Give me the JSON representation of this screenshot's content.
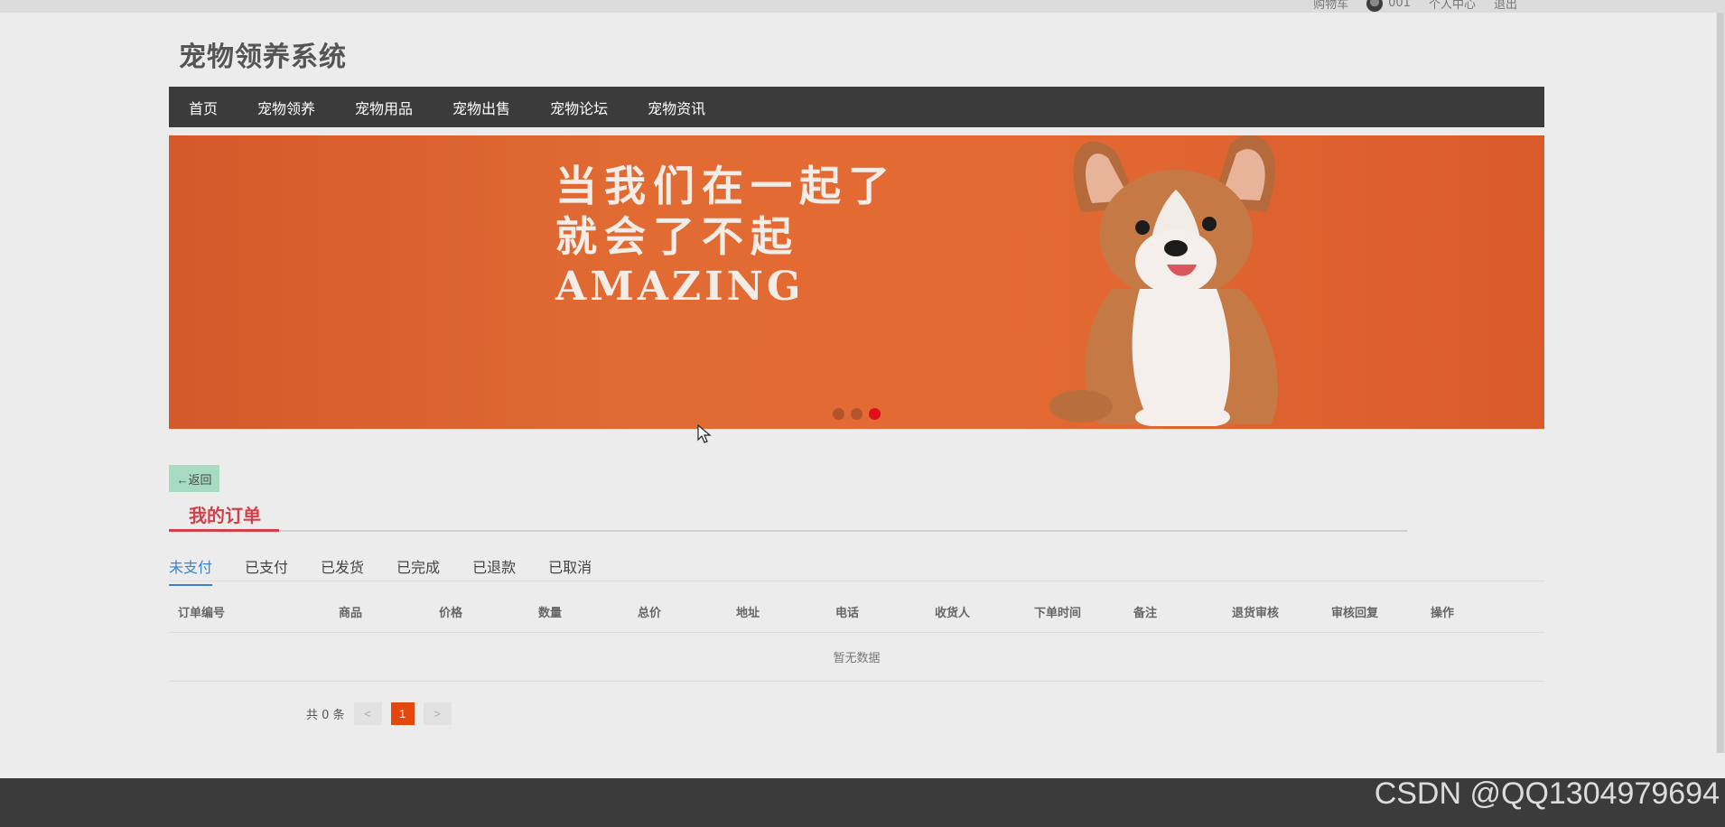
{
  "top_bar": {
    "cart_label": "购物车",
    "username": "001",
    "profile_label": "个人中心",
    "logout_label": "退出"
  },
  "header": {
    "site_title": "宠物领养系统"
  },
  "nav": {
    "items": [
      "首页",
      "宠物领养",
      "宠物用品",
      "宠物出售",
      "宠物论坛",
      "宠物资讯"
    ]
  },
  "banner": {
    "line1": "当我们在一起了",
    "line2": "就会了不起",
    "line3": "AMAZING",
    "slide_count": 3,
    "active_slide": 3,
    "accent_color": "#e0101a"
  },
  "page": {
    "back_label": "←返回",
    "section_title": "我的订单",
    "title_color": "#d2404a"
  },
  "status_tabs": {
    "items": [
      "未支付",
      "已支付",
      "已发货",
      "已完成",
      "已退款",
      "已取消"
    ],
    "active_index": 0,
    "active_color": "#3a83d2"
  },
  "orders_table": {
    "columns": [
      "订单编号",
      "商品",
      "价格",
      "数量",
      "总价",
      "地址",
      "电话",
      "收货人",
      "下单时间",
      "备注",
      "退货审核",
      "审核回复",
      "操作"
    ],
    "rows": [],
    "empty_text": "暂无数据"
  },
  "pagination": {
    "total_text": "共 0 条",
    "prev_label": "<",
    "current_page": "1",
    "next_label": ">",
    "current_color": "#e3470c"
  },
  "watermark": {
    "text": "CSDN @QQ1304979694"
  }
}
